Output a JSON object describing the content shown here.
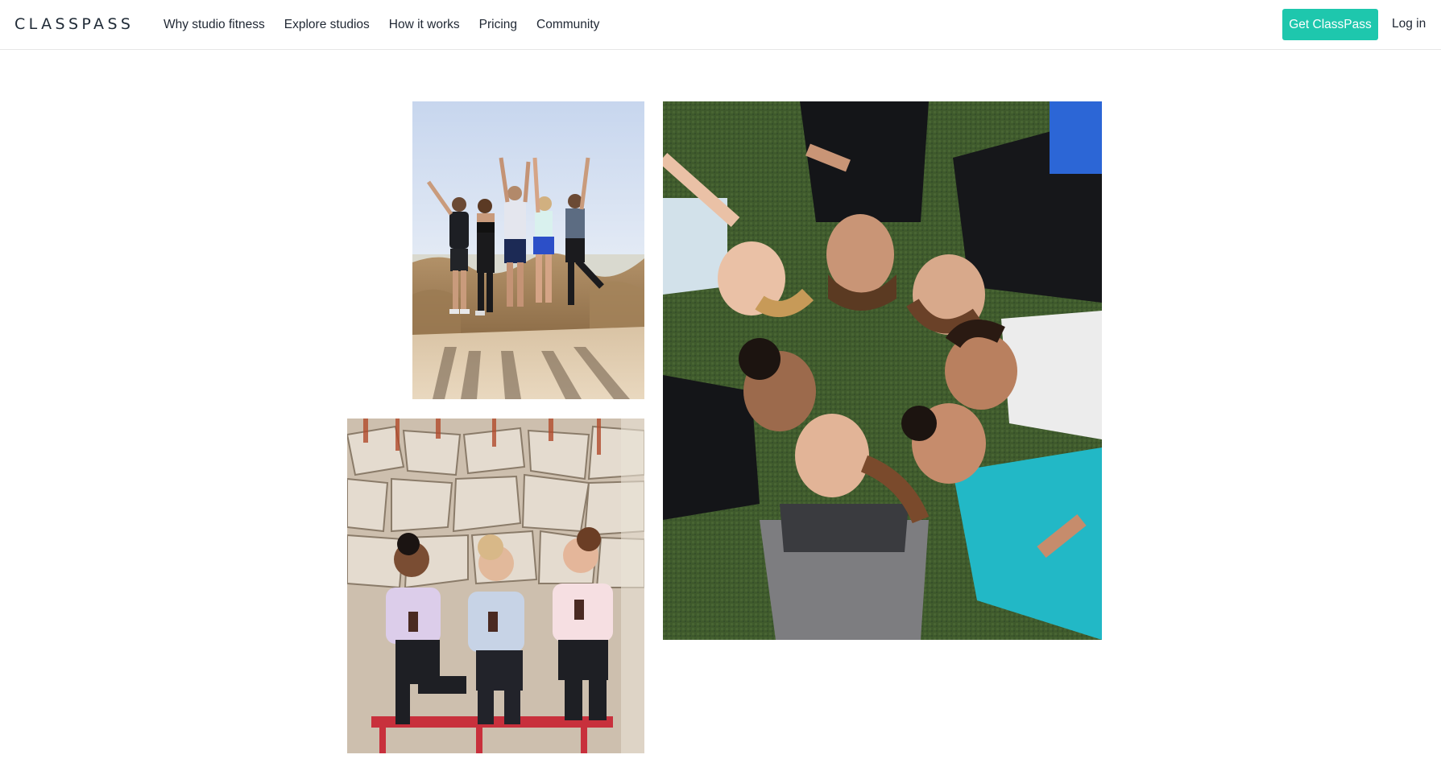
{
  "header": {
    "logo_text": "CLASSPASS",
    "nav": [
      {
        "label": "Why studio fitness"
      },
      {
        "label": "Explore studios"
      },
      {
        "label": "How it works"
      },
      {
        "label": "Pricing"
      },
      {
        "label": "Community"
      }
    ],
    "cta_label": "Get ClassPass",
    "login_label": "Log in"
  },
  "colors": {
    "accent": "#1ec7ad",
    "text": "#1f2733",
    "divider": "#e6e6e6"
  },
  "photos": [
    {
      "name": "group-cheering-on-trail-photo"
    },
    {
      "name": "friends-drinking-smoothies-photo"
    },
    {
      "name": "group-lying-on-grass-photo"
    }
  ]
}
